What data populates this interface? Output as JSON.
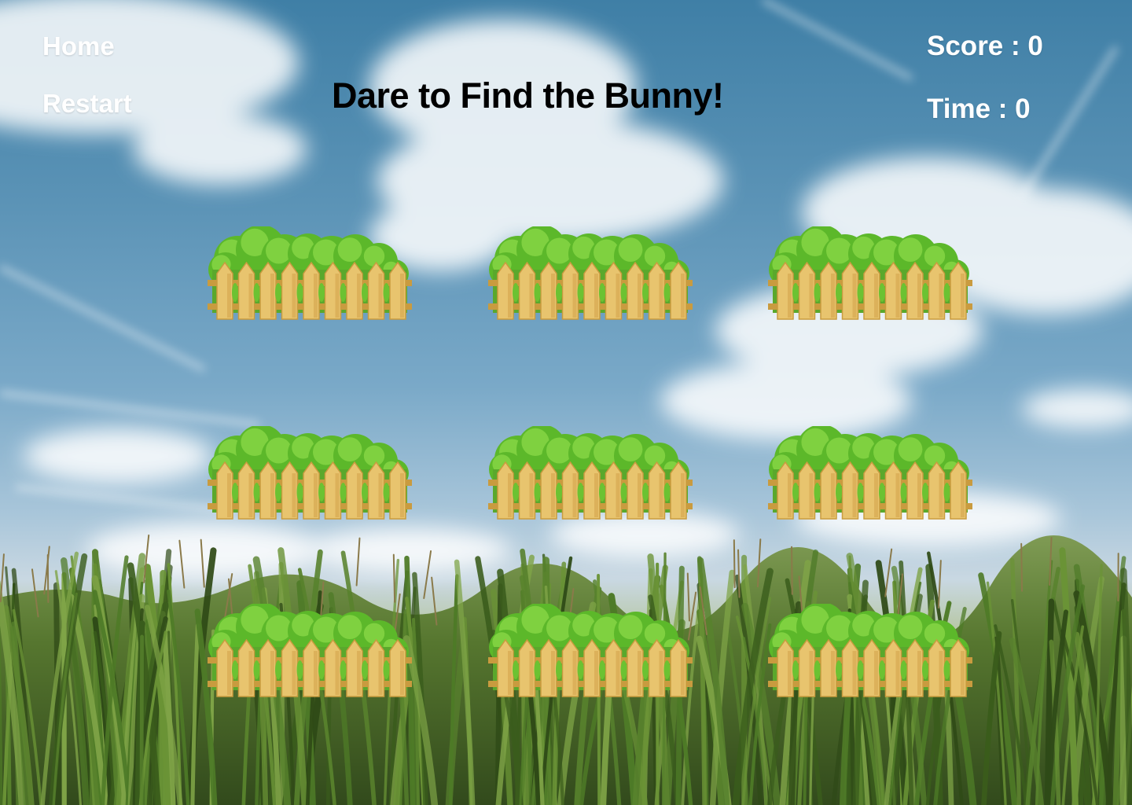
{
  "nav": {
    "home_label": "Home",
    "restart_label": "Restart"
  },
  "title": "Dare to Find the Bunny!",
  "stats": {
    "score_label": "Score : ",
    "score_value": "0",
    "time_label": "Time : ",
    "time_value": "0"
  },
  "board": {
    "rows": 3,
    "cols": 3,
    "holes": [
      {
        "row": 1,
        "col": 1
      },
      {
        "row": 1,
        "col": 2
      },
      {
        "row": 1,
        "col": 3
      },
      {
        "row": 2,
        "col": 1
      },
      {
        "row": 2,
        "col": 2
      },
      {
        "row": 2,
        "col": 3
      },
      {
        "row": 3,
        "col": 1
      },
      {
        "row": 3,
        "col": 2
      },
      {
        "row": 3,
        "col": 3
      }
    ]
  },
  "icons": {
    "hole": "bush-fence-icon"
  },
  "colors": {
    "sky": "#4f89ae",
    "cloud": "#ffffff",
    "bush": "#5cb82a",
    "fence": "#e8c46e",
    "fence_dark": "#c99b3f",
    "field": "#4c6e2c",
    "title": "#000000",
    "hud_text": "#ffffff"
  }
}
